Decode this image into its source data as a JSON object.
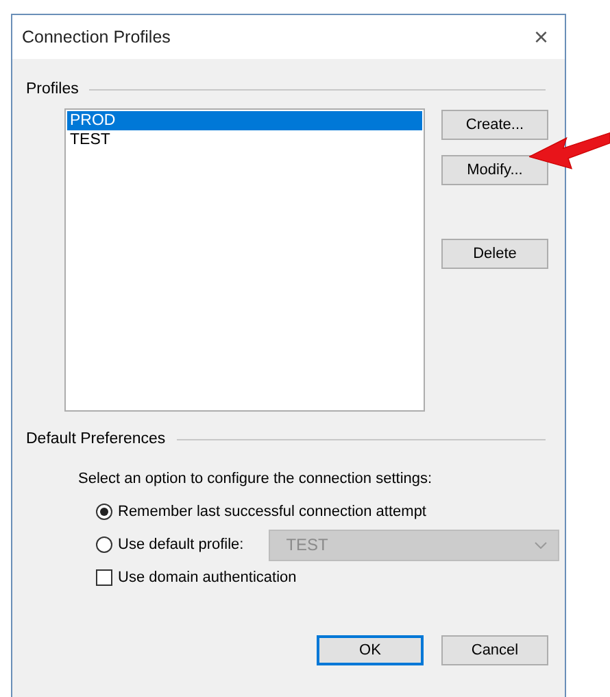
{
  "window": {
    "title": "Connection Profiles",
    "close": "×"
  },
  "profiles": {
    "label": "Profiles",
    "items": [
      {
        "name": "PROD",
        "selected": true
      },
      {
        "name": "TEST",
        "selected": false
      }
    ],
    "buttons": [
      "Create...",
      "Modify...",
      "Delete"
    ]
  },
  "preferences": {
    "label": "Default Preferences",
    "instruction": "Select an option to configure the connection settings:",
    "options": [
      {
        "label": "Remember last successful connection attempt",
        "selected": true
      },
      {
        "label": "Use default profile:",
        "selected": false
      }
    ],
    "default_profile": {
      "value": "TEST",
      "disabled": true
    },
    "domain_auth": {
      "label": "Use domain authentication",
      "checked": false
    }
  },
  "buttons": [
    {
      "label": "OK",
      "default": true
    },
    {
      "label": "Cancel",
      "default": false
    }
  ]
}
